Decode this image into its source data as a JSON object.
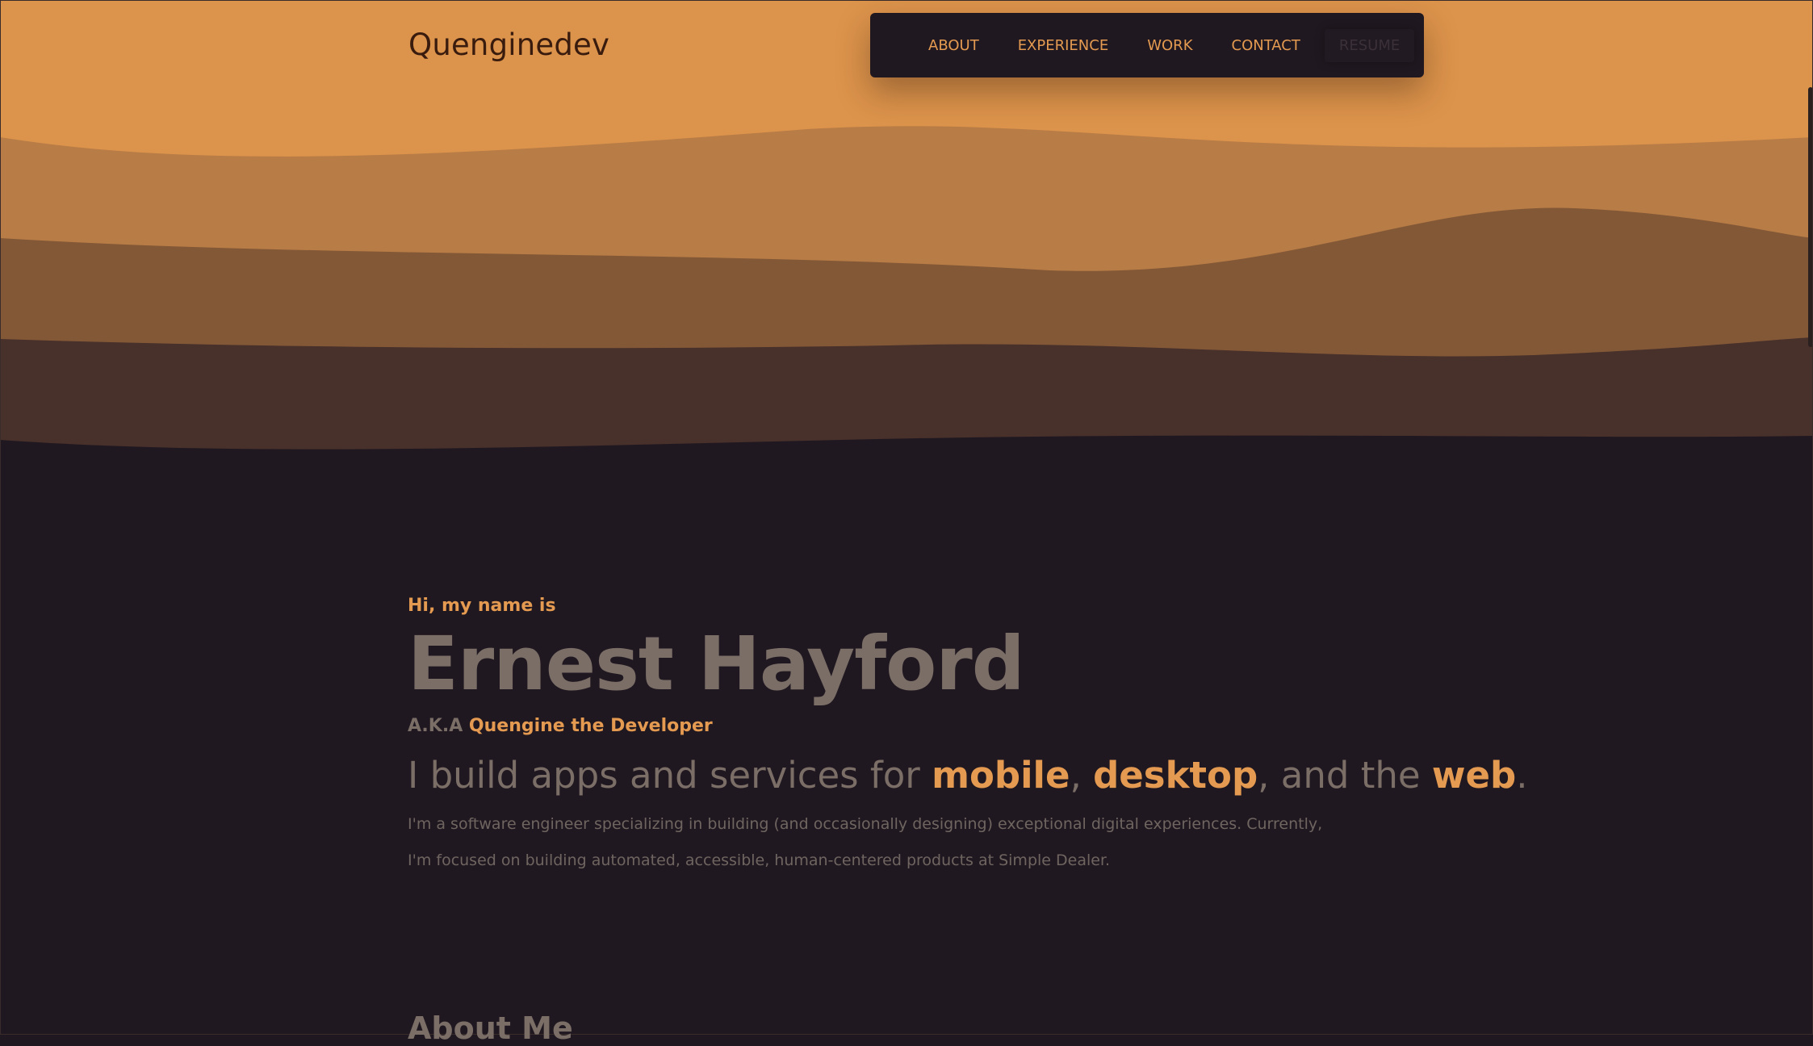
{
  "header": {
    "brand": "Quenginedev",
    "nav": [
      "ABOUT",
      "EXPERIENCE",
      "WORK",
      "CONTACT"
    ],
    "resume_label": "RESUME"
  },
  "hero": {
    "greeting": "Hi, my name is",
    "name": "Ernest Hayford",
    "aka_prefix": "A.K.A",
    "aka_name": "Quengine the Developer",
    "tagline": {
      "part1": "I build apps and services for ",
      "mobile": "mobile",
      "comma1": ", ",
      "desktop": "desktop",
      "part2": ", and the ",
      "web": "web",
      "end": "."
    },
    "bio_line1": "I'm a software engineer specializing in building (and occasionally designing) exceptional digital experiences. Currently,",
    "bio_line2": "I'm focused on building automated, accessible, human-centered products at Simple Dealer."
  },
  "about": {
    "heading": "About Me"
  },
  "colors": {
    "accent": "#e49a50",
    "background": "#201820",
    "wave_1": "#dc934b",
    "wave_2": "#b87c46",
    "wave_3": "#835836",
    "wave_4": "#48302b",
    "muted_text": "#7a6e67"
  }
}
